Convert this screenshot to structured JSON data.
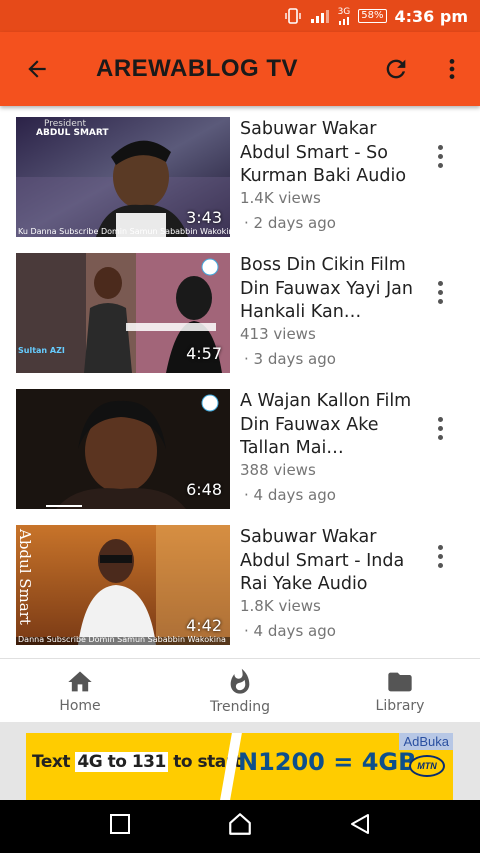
{
  "status_bar": {
    "network": "3G",
    "battery": "58%",
    "time": "4:36 pm"
  },
  "app_bar": {
    "title": "AREWABLOG TV",
    "back_icon": "arrow-left-icon",
    "refresh_icon": "refresh-icon",
    "menu_icon": "more-vert-icon"
  },
  "videos": [
    {
      "title": "Sabuwar Wakar Abdul Smart - So Kurman Baki Audio",
      "views": "1.4K views",
      "age": "· 2 days ago",
      "duration": "3:43",
      "overlay": "Ku Danna Subscribe Domin Samun Sababbin Wakokina",
      "thumb_top_text": "President",
      "thumb_name_text": "ABDUL SMART"
    },
    {
      "title": "Boss Din Cikin Film Din Fauwax Yayi Jan Hankali Kan…",
      "views": "413 views",
      "age": "· 3 days ago",
      "duration": "4:57",
      "overlay": "Sultan AZI"
    },
    {
      "title": "A Wajan Kallon Film Din Fauwax Ake Tallan Mai…",
      "views": "388 views",
      "age": "· 4 days ago",
      "duration": "6:48"
    },
    {
      "title": "Sabuwar Wakar Abdul Smart - Inda Rai Yake Audio",
      "views": "1.8K views",
      "age": "· 4 days ago",
      "duration": "4:42",
      "overlay": "Danna Subscribe Domin Samun Sababbin Wakokina",
      "thumb_name_text": "Abdul Smart"
    }
  ],
  "bottom_nav": [
    {
      "label": "Home",
      "icon": "home-icon"
    },
    {
      "label": "Trending",
      "icon": "flame-icon"
    },
    {
      "label": "Library",
      "icon": "folder-icon"
    }
  ],
  "ad": {
    "label": "AdBuka",
    "left_text_1": "Text ",
    "left_boxed_1": "4G to 131",
    "left_text_2": " to start",
    "right_text": "N1200 = 4GB",
    "logo": "MTN",
    "colors": {
      "background": "#ffcc00",
      "text": "#0d4f8b"
    }
  },
  "colors": {
    "status_bar": "#e64a19",
    "app_bar": "#f4511e"
  }
}
